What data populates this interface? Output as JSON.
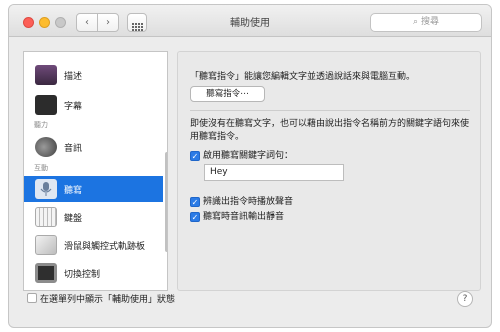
{
  "window": {
    "title": "輔助使用"
  },
  "search": {
    "placeholder": "搜尋"
  },
  "icons": {
    "back": "chevron-left-icon",
    "forward": "chevron-right-icon",
    "grid": "grid-icon",
    "search": "magnifier-icon",
    "help": "question-icon"
  },
  "sidebar": {
    "items": [
      {
        "label": "描述"
      },
      {
        "label": "字幕"
      },
      {
        "label": "音訊"
      },
      {
        "label": "聽寫"
      },
      {
        "label": "鍵盤"
      },
      {
        "label": "滑鼠與觸控式軌跡板"
      },
      {
        "label": "切換控制"
      }
    ],
    "categories": {
      "hearing": "聽力",
      "interaction": "互動"
    }
  },
  "content": {
    "description": "「聽寫指令」能讓您編輯文字並透過說話來與電腦互動。",
    "commands_button": "聽寫指令⋯",
    "keyword_description": "即使沒有在聽寫文字，也可以藉由說出指令名稱前方的關鍵字語句來使用聽寫指令。",
    "enable_keyword_label": "啟用聽寫關鍵字詞句：",
    "enable_keyword_checked": true,
    "keyword_value": "Hey",
    "play_sound_label": "辨識出指令時播放聲音",
    "play_sound_checked": true,
    "mute_audio_label": "聽寫時音訊輸出靜音",
    "mute_audio_checked": true
  },
  "footer": {
    "show_in_menubar_label": "在選單列中顯示「輔助使用」狀態",
    "show_in_menubar_checked": false,
    "help": "?"
  },
  "colors": {
    "selection": "#1c74e1",
    "checkbox": "#2b7be6"
  }
}
